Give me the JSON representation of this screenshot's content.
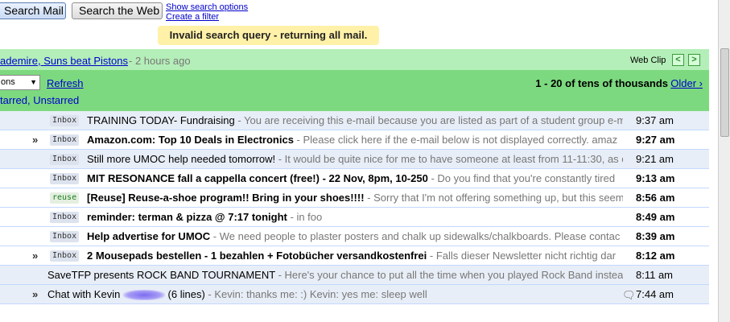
{
  "search": {
    "search_mail_label": "Search Mail",
    "search_web_label": "Search the Web",
    "show_options_label": "Show search options",
    "create_filter_label": "Create a filter"
  },
  "notice": {
    "text": "Invalid search query - returning all mail."
  },
  "webclip": {
    "headline": "ademire, Suns beat Pistons",
    "time": " - 2 hours ago",
    "label": "Web Clip",
    "prev_icon": "chevron-left-icon",
    "next_icon": "chevron-right-icon"
  },
  "toolbar": {
    "actions_value": "ons",
    "refresh_label": "Refresh",
    "starred_label": "tarred",
    "unstarred_label": "Unstarred",
    "page_range": "1 - 20",
    "page_of": " of tens of thousands",
    "older_label": "Older ›"
  },
  "messages": [
    {
      "important": "",
      "label": "Inbox",
      "subject": "TRAINING TODAY- Fundraising",
      "snippet": " - You are receiving this e-mail because you are listed as part of a student group e-m",
      "time": "9:37 am",
      "unread": false
    },
    {
      "important": "»",
      "label": "Inbox",
      "subject": "Amazon.com: Top 10 Deals in Electronics",
      "snippet": " - Please click here if the e-mail below is not displayed correctly. amaz",
      "time": "9:27 am",
      "unread": true
    },
    {
      "important": "",
      "label": "Inbox",
      "subject": "Still more UMOC help needed tomorrow!",
      "snippet": " - It would be quite nice for me to have someone at least from 11-11:30, as c",
      "time": "9:21 am",
      "unread": false
    },
    {
      "important": "",
      "label": "Inbox",
      "subject": "MIT RESONANCE fall a cappella concert (free!) - 22 Nov, 8pm, 10-250",
      "snippet": " - Do you find that you're constantly tired",
      "time": "9:13 am",
      "unread": true
    },
    {
      "important": "",
      "label": "reuse",
      "subject": "[Reuse] Reuse-a-shoe program!! Bring in your shoes!!!!",
      "snippet": " - Sorry that I'm not offering something up, but this seem",
      "time": "8:56 am",
      "unread": true
    },
    {
      "important": "",
      "label": "Inbox",
      "subject": "reminder: terman & pizza @ 7:17 tonight",
      "snippet": " - in foo",
      "time": "8:49 am",
      "unread": true
    },
    {
      "important": "",
      "label": "Inbox",
      "subject": "Help advertise for UMOC",
      "snippet": " - We need people to plaster posters and chalk up sidewalks/chalkboards. Please contac",
      "time": "8:39 am",
      "unread": true
    },
    {
      "important": "»",
      "label": "Inbox",
      "subject": "2 Mousepads bestellen - 1 bezahlen + Fotobücher versandkostenfrei",
      "snippet": " - Falls dieser Newsletter nicht richtig dar",
      "time": "8:12 am",
      "unread": true
    },
    {
      "important": "",
      "label": "",
      "subject": "SaveTFP presents ROCK BAND TOURNAMENT",
      "snippet": " - Here's your chance to put all the time when you played Rock Band instea",
      "time": "8:11 am",
      "unread": false
    },
    {
      "important": "»",
      "label": "",
      "subject": "Chat with Kevin ",
      "subject_suffix": " (6 lines)",
      "snippet": " - Kevin: thanks me: :) Kevin: yes me: sleep well",
      "time": "7:44 am",
      "unread": false,
      "chat_icon": "chat-bubble-icon"
    }
  ]
}
